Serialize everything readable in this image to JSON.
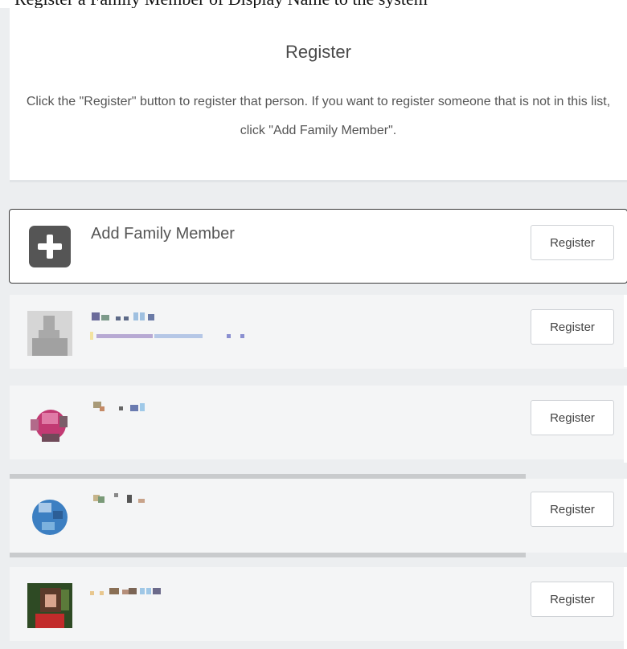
{
  "top_cutoff_text": "Register a Family Member of Display Name to the system",
  "header": {
    "title": "Register",
    "description": "Click the \"Register\" button to register that person. If you want to register someone that is not in this list, click \"Add Family Member\"."
  },
  "add_member": {
    "label": "Add Family Member",
    "icon": "plus-icon",
    "button_label": "Register"
  },
  "people": [
    {
      "avatar": "avatar-silhouette",
      "button_label": "Register"
    },
    {
      "avatar": "avatar-pink-flower",
      "button_label": "Register"
    },
    {
      "avatar": "avatar-blue-globe",
      "button_label": "Register"
    },
    {
      "avatar": "avatar-photo-person",
      "button_label": "Register"
    }
  ],
  "colors": {
    "background": "#eceef0",
    "card": "#ffffff",
    "row": "#f4f5f6",
    "icon_dark": "#555555",
    "text": "#555555"
  }
}
